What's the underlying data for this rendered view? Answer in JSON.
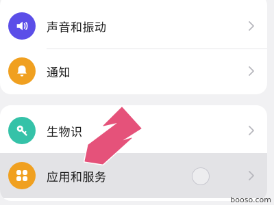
{
  "settings_top": {
    "items": [
      {
        "label": "声音和振动",
        "icon": "speaker-icon",
        "icon_color": "#5b4ee8"
      },
      {
        "label": "通知",
        "icon": "bell-icon",
        "icon_color": "#f0a020"
      }
    ]
  },
  "settings_bottom": {
    "items": [
      {
        "label": "生物识",
        "icon": "key-icon",
        "icon_color": "#35c2a8"
      },
      {
        "label": "应用和服务",
        "icon": "apps-grid-icon",
        "icon_color": "#f0a020"
      }
    ]
  },
  "overlay": {
    "arrow_color": "#e5527a",
    "watermark": "booso.com"
  }
}
